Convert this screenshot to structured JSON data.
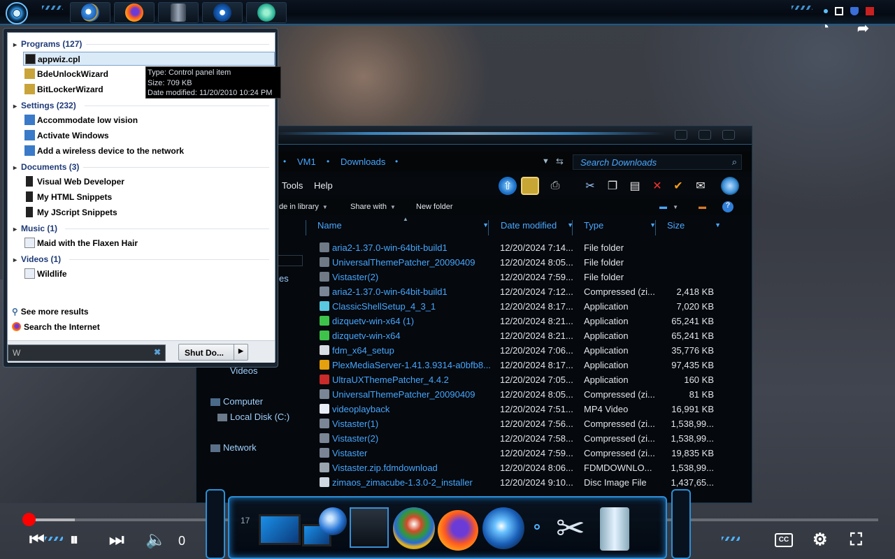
{
  "start_menu": {
    "categories": [
      {
        "label": "Programs (127)"
      },
      {
        "label": "Settings (232)"
      },
      {
        "label": "Documents (3)"
      },
      {
        "label": "Music (1)"
      },
      {
        "label": "Videos (1)"
      }
    ],
    "programs": [
      "appwiz.cpl",
      "BdeUnlockWizard",
      "BitLockerWizard"
    ],
    "settings": [
      "Accommodate low vision",
      "Activate Windows",
      "Add a wireless device to the network"
    ],
    "documents": [
      "Visual Web Developer",
      "My HTML Snippets",
      "My JScript Snippets"
    ],
    "music": [
      "Maid with the Flaxen Hair"
    ],
    "videos": [
      "Wildlife"
    ],
    "see_more": "See more results",
    "search_internet": "Search the Internet",
    "search_value": "W",
    "shutdown_label": "Shut Do..."
  },
  "tooltip": {
    "line1": "Type: Control panel item",
    "line2": "Size: 709 KB",
    "line3": "Date modified: 11/20/2010 10:24 PM"
  },
  "explorer": {
    "breadcrumb": [
      "VM1",
      "Downloads"
    ],
    "search_placeholder": "Search Downloads",
    "menu": {
      "tools": "Tools",
      "help": "Help"
    },
    "cmd": {
      "include": "de in library",
      "share": "Share with",
      "new_folder": "New folder"
    },
    "columns": {
      "name": "Name",
      "date": "Date modified",
      "type": "Type",
      "size": "Size"
    },
    "nav": {
      "es": "es",
      "videos": "Videos",
      "computer": "Computer",
      "local_disk": "Local Disk (C:)",
      "network": "Network"
    },
    "files": [
      {
        "name": "aria2-1.37.0-win-64bit-build1",
        "date": "12/20/2024 7:14...",
        "type": "File folder",
        "size": "",
        "icon": "folder"
      },
      {
        "name": "UniversalThemePatcher_20090409",
        "date": "12/20/2024 8:05...",
        "type": "File folder",
        "size": "",
        "icon": "folder"
      },
      {
        "name": "Vistaster(2)",
        "date": "12/20/2024 7:59...",
        "type": "File folder",
        "size": "",
        "icon": "folder"
      },
      {
        "name": "aria2-1.37.0-win-64bit-build1",
        "date": "12/20/2024 7:12...",
        "type": "Compressed (zi...",
        "size": "2,418 KB",
        "icon": "zip"
      },
      {
        "name": "ClassicShellSetup_4_3_1",
        "date": "12/20/2024 8:17...",
        "type": "Application",
        "size": "7,020 KB",
        "icon": "shell"
      },
      {
        "name": "dizquetv-win-x64 (1)",
        "date": "12/20/2024 8:21...",
        "type": "Application",
        "size": "65,241 KB",
        "icon": "cube"
      },
      {
        "name": "dizquetv-win-x64",
        "date": "12/20/2024 8:21...",
        "type": "Application",
        "size": "65,241 KB",
        "icon": "cube"
      },
      {
        "name": "fdm_x64_setup",
        "date": "12/20/2024 7:06...",
        "type": "Application",
        "size": "35,776 KB",
        "icon": "download"
      },
      {
        "name": "PlexMediaServer-1.41.3.9314-a0bfb8...",
        "date": "12/20/2024 8:17...",
        "type": "Application",
        "size": "97,435 KB",
        "icon": "plex"
      },
      {
        "name": "UltraUXThemePatcher_4.4.2",
        "date": "12/20/2024 7:05...",
        "type": "Application",
        "size": "160 KB",
        "icon": "patcher"
      },
      {
        "name": "UniversalThemePatcher_20090409",
        "date": "12/20/2024 8:05...",
        "type": "Compressed (zi...",
        "size": "81 KB",
        "icon": "zip"
      },
      {
        "name": "videoplayback",
        "date": "12/20/2024 7:51...",
        "type": "MP4 Video",
        "size": "16,991 KB",
        "icon": "video"
      },
      {
        "name": "Vistaster(1)",
        "date": "12/20/2024 7:56...",
        "type": "Compressed (zi...",
        "size": "1,538,99...",
        "icon": "zip"
      },
      {
        "name": "Vistaster(2)",
        "date": "12/20/2024 7:58...",
        "type": "Compressed (zi...",
        "size": "1,538,99...",
        "icon": "zip"
      },
      {
        "name": "Vistaster",
        "date": "12/20/2024 7:59...",
        "type": "Compressed (zi...",
        "size": "19,835 KB",
        "icon": "zip"
      },
      {
        "name": "Vistaster.zip.fdmdownload",
        "date": "12/20/2024 8:06...",
        "type": "FDMDOWNLO...",
        "size": "1,538,99...",
        "icon": "file"
      },
      {
        "name": "zimaos_zimacube-1.3.0-2_installer",
        "date": "12/20/2024 9:10...",
        "type": "Disc Image File",
        "size": "1,437,65...",
        "icon": "disc"
      }
    ]
  },
  "player": {
    "time": "0",
    "progress": 0.006,
    "loaded": 0.06,
    "cc_label": "CC"
  },
  "dock": {
    "number": "17"
  },
  "colors": {
    "accent": "#46a6ff",
    "player_red": "#ff0000",
    "frame_blue": "#2c8fd6"
  }
}
